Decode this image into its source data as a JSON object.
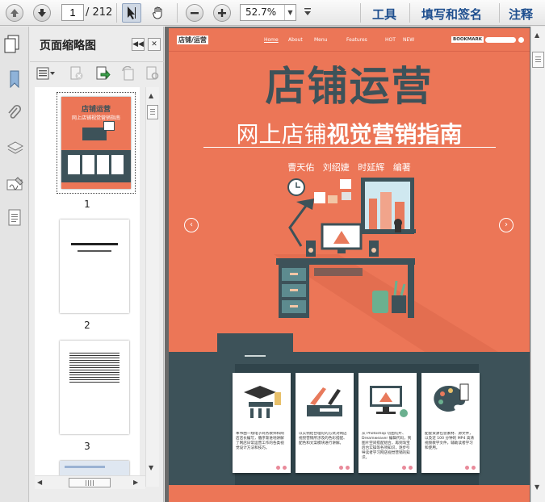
{
  "toolbar": {
    "current_page": "1",
    "total_pages": "/ 212",
    "zoom": "52.7%",
    "menu": [
      "工具",
      "填写和签名",
      "注释"
    ],
    "icons": [
      "arrow-up-icon",
      "arrow-down-icon",
      "select-arrow-icon",
      "hand-icon",
      "zoom-out-icon",
      "zoom-in-icon"
    ]
  },
  "panel": {
    "title": "页面缩略图",
    "thumbnails": [
      {
        "number": "1",
        "title": "店铺运营",
        "subtitle": "网上店铺视觉营销指南"
      },
      {
        "number": "2"
      },
      {
        "number": "3"
      }
    ]
  },
  "page": {
    "header_logo": "店铺/运营",
    "nav": [
      "Home",
      "About",
      "Menu",
      "Features",
      "HOT",
      "NEW"
    ],
    "bookmark": "BOOKMARK",
    "title": "店铺运营",
    "subtitle_light": "网上店铺",
    "subtitle_bold": "视觉营销指南",
    "authors": "曹天佑   刘绍婕   时延辉   编著",
    "cards": [
      "本书由一线电子商务教师和网店店长编写，循序渐进地讲解了网店日常运营工作的各类视觉设计方法和技巧。",
      "以实例结合理论的方式对网店视觉营销所涉及的色彩搭配、配色和文案模块进行讲解。",
      "从 Photoshop 切图切片、Dreamweaver 编辑代码，到图片空间搭配组合，再到淘宝后台实操等各项知识，逐步引导读者学习网店视觉营销的知识。",
      "配套资源包含素材、源文件，以及近 100 分钟的 MP4 高清视频教学文件，辅助读者学习和使用。"
    ],
    "colors": {
      "background": "#ec7657",
      "dark": "#3d5259",
      "accent": "#f2c6a6"
    }
  }
}
